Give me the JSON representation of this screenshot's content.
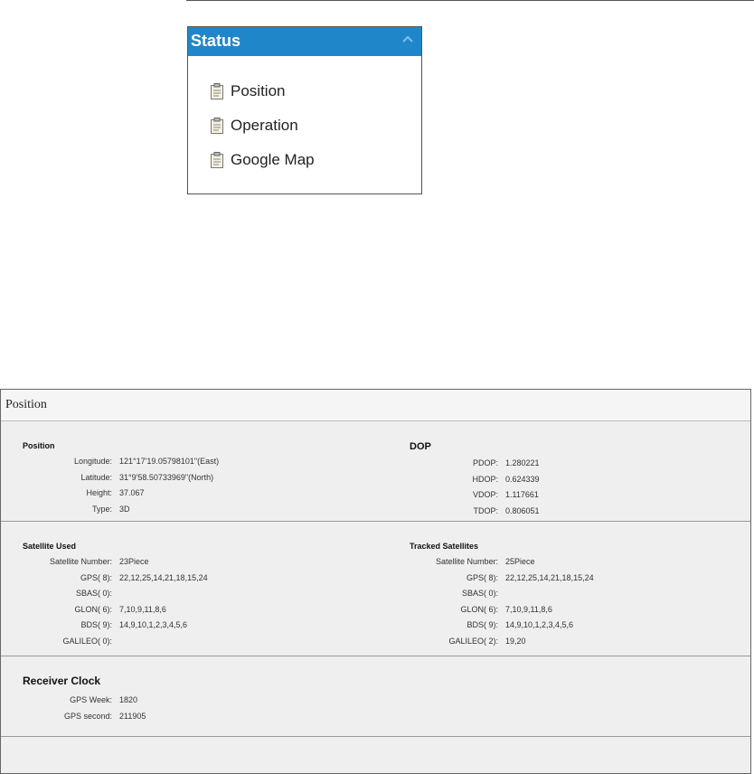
{
  "status_widget": {
    "title": "Status",
    "items": [
      {
        "label": "Position"
      },
      {
        "label": "Operation"
      },
      {
        "label": "Google Map"
      }
    ]
  },
  "panel": {
    "title": "Position",
    "position": {
      "heading": "Position",
      "rows": [
        {
          "label": "Longitude:",
          "value": "121°17'19.05798101\"(East)"
        },
        {
          "label": "Latitude:",
          "value": "31°9'58.50733969\"(North)"
        },
        {
          "label": "Height:",
          "value": "37.067"
        },
        {
          "label": "Type:",
          "value": "3D"
        }
      ]
    },
    "dop": {
      "heading": "DOP",
      "rows": [
        {
          "label": "PDOP:",
          "value": "1.280221"
        },
        {
          "label": "HDOP:",
          "value": "0.624339"
        },
        {
          "label": "VDOP:",
          "value": "1.117661"
        },
        {
          "label": "TDOP:",
          "value": "0.806051"
        }
      ]
    },
    "satellite_used": {
      "heading": "Satellite Used",
      "rows": [
        {
          "label": "Satellite Number:",
          "value": "23Piece"
        },
        {
          "label": "GPS( 8):",
          "value": "22,12,25,14,21,18,15,24"
        },
        {
          "label": "SBAS( 0):",
          "value": ""
        },
        {
          "label": "GLON( 6):",
          "value": "7,10,9,11,8,6"
        },
        {
          "label": "BDS( 9):",
          "value": "14,9,10,1,2,3,4,5,6"
        },
        {
          "label": "GALILEO( 0):",
          "value": ""
        }
      ]
    },
    "tracked_satellites": {
      "heading": "Tracked Satellites",
      "rows": [
        {
          "label": "Satellite Number:",
          "value": "25Piece"
        },
        {
          "label": "GPS( 8):",
          "value": "22,12,25,14,21,18,15,24"
        },
        {
          "label": "SBAS( 0):",
          "value": ""
        },
        {
          "label": "GLON( 6):",
          "value": "7,10,9,11,8,6"
        },
        {
          "label": "BDS( 9):",
          "value": "14,9,10,1,2,3,4,5,6"
        },
        {
          "label": "GALILEO( 2):",
          "value": "19,20"
        }
      ]
    },
    "receiver_clock": {
      "heading": "Receiver Clock",
      "rows": [
        {
          "label": "GPS Week:",
          "value": "1820"
        },
        {
          "label": "GPS second:",
          "value": "211905"
        }
      ]
    }
  },
  "colors": {
    "header_blue": "#1f87c9",
    "panel_bg": "#efefef"
  }
}
